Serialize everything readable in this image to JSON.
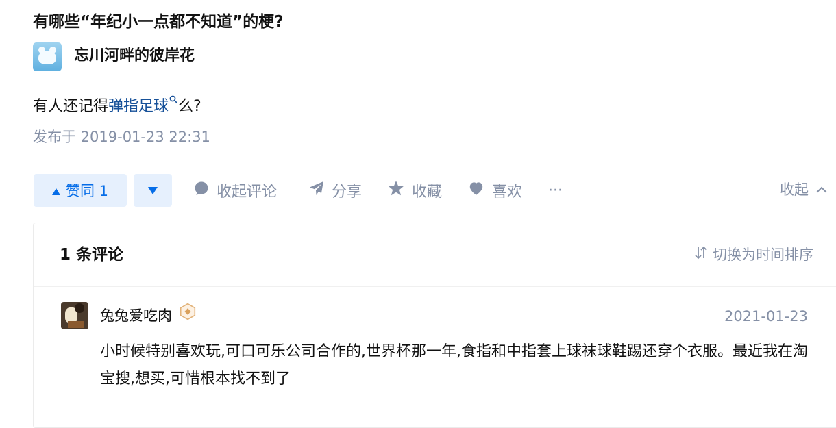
{
  "question": {
    "title": "有哪些“年纪小一点都不知道”的梗?"
  },
  "author": {
    "name": "忘川河畔的彼岸花",
    "avatar_icon": "bear-avatar-icon"
  },
  "answer": {
    "text_before": "有人还记得",
    "link_text": "弹指足球",
    "text_after": "么?",
    "published": "发布于 2019-01-23 22:31"
  },
  "actions": {
    "upvote_label": "赞同 1",
    "comment_toggle": "收起评论",
    "share": "分享",
    "favorite": "收藏",
    "like": "喜欢",
    "more": "···",
    "collapse": "收起"
  },
  "comments": {
    "count_label": "1 条评论",
    "sort_label": "切换为时间排序",
    "items": [
      {
        "author": "兔兔爱吃肉",
        "date": "2021-01-23",
        "text": "小时候特别喜欢玩,可口可乐公司合作的,世界杯那一年,食指和中指套上球袜球鞋踢还穿个衣服。最近我在淘宝搜,想买,可惜根本找不到了"
      }
    ]
  },
  "colors": {
    "accent": "#056de8",
    "link": "#175199",
    "muted": "#8590a6",
    "text": "#121212"
  }
}
